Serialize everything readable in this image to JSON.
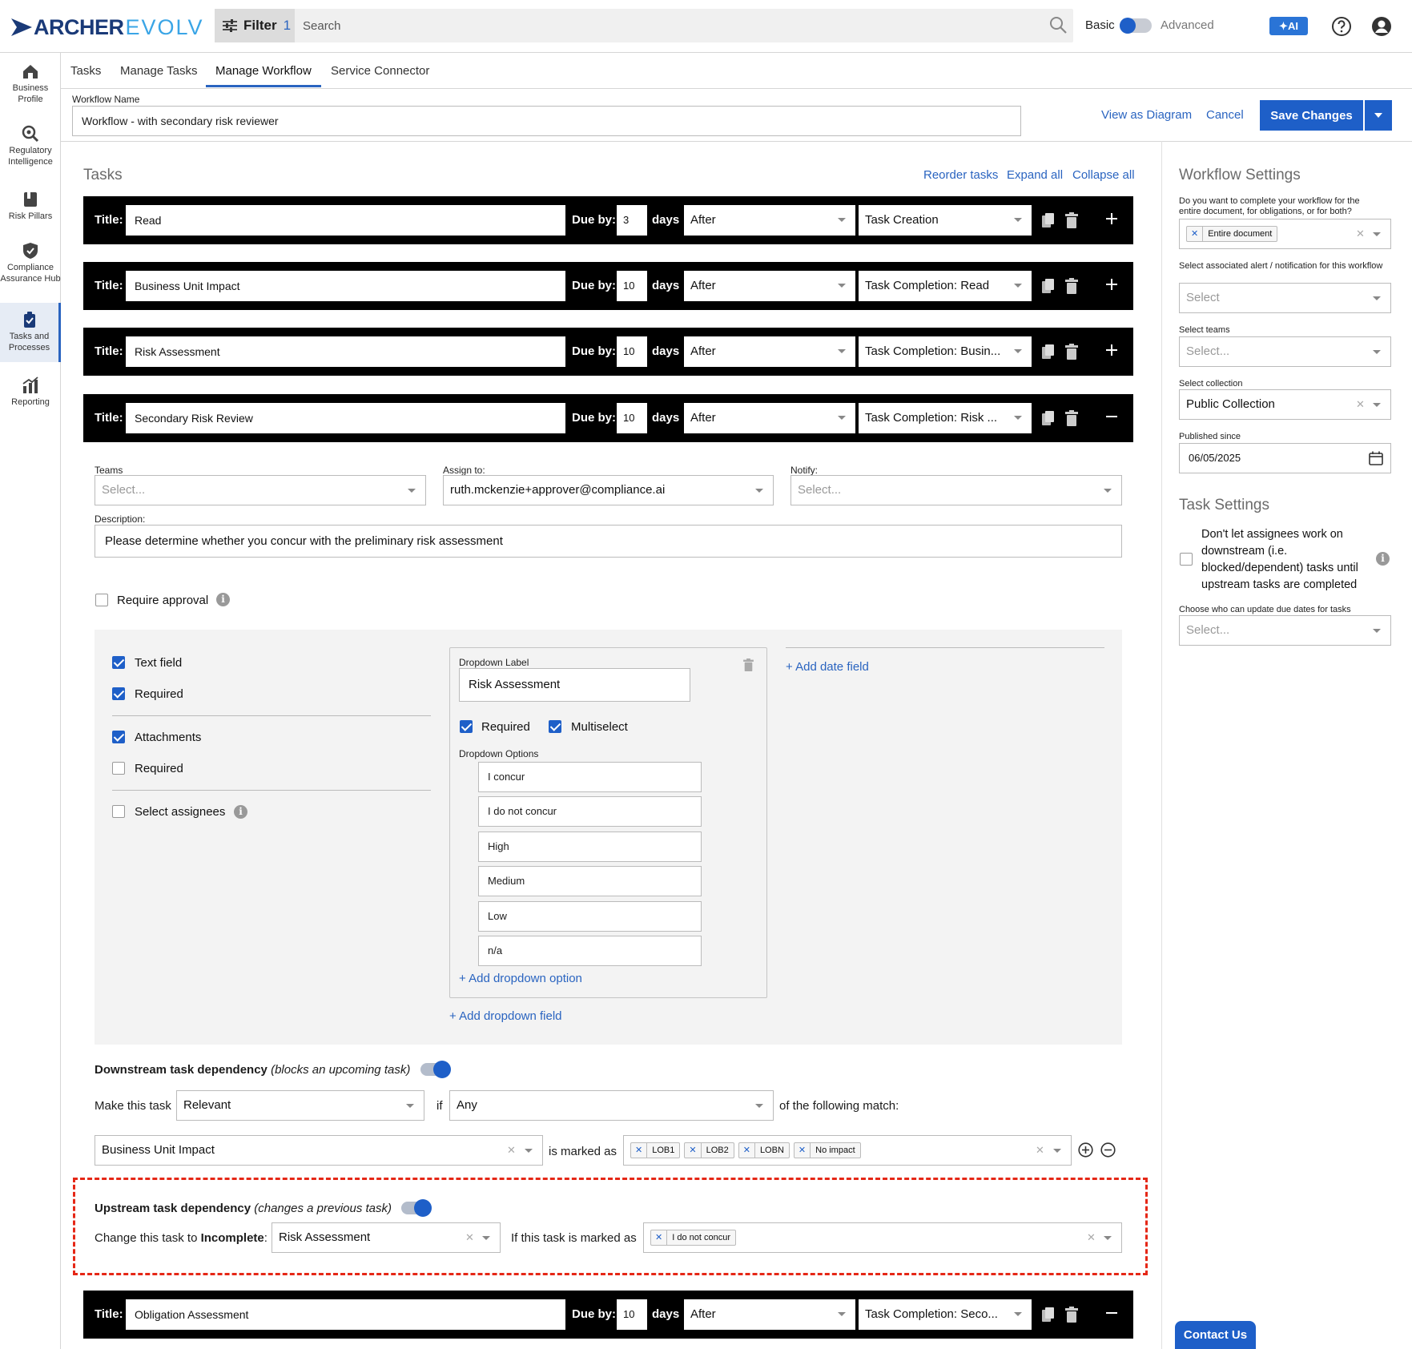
{
  "app": {
    "logo_main": "ARCHER",
    "logo_sub": "EVOLV",
    "filter_label": "Filter",
    "filter_count": "1",
    "search_label": "Search",
    "mode_basic": "Basic",
    "mode_advanced": "Advanced",
    "ai_label": "AI"
  },
  "nav": [
    {
      "label": "Business Profile",
      "icon": "house-icon"
    },
    {
      "label": "Regulatory Intelligence",
      "icon": "magnify-icon"
    },
    {
      "label": "Risk Pillars",
      "icon": "book-icon"
    },
    {
      "label": "Compliance Assurance Hub",
      "icon": "shield-icon"
    },
    {
      "label": "Tasks and Processes",
      "icon": "clipboard-icon"
    },
    {
      "label": "Reporting",
      "icon": "chart-icon"
    }
  ],
  "tabs": [
    "Tasks",
    "Manage Tasks",
    "Manage Workflow",
    "Service Connector"
  ],
  "workflow": {
    "name_label": "Workflow Name",
    "name_value": "Workflow - with secondary risk reviewer",
    "view_diagram": "View as Diagram",
    "cancel": "Cancel",
    "save": "Save Changes"
  },
  "tasks_header": {
    "title": "Tasks",
    "reorder": "Reorder tasks",
    "expand": "Expand all",
    "collapse": "Collapse all"
  },
  "row_labels": {
    "title": "Title:",
    "due_by": "Due by:",
    "days": "days"
  },
  "tasks": [
    {
      "title": "Read",
      "due": "3",
      "when": "After",
      "trigger": "Task Creation"
    },
    {
      "title": "Business Unit Impact",
      "due": "10",
      "when": "After",
      "trigger": "Task Completion: Read"
    },
    {
      "title": "Risk Assessment",
      "due": "10",
      "when": "After",
      "trigger": "Task Completion: Busin..."
    },
    {
      "title": "Secondary Risk Review",
      "due": "10",
      "when": "After",
      "trigger": "Task Completion: Risk ..."
    },
    {
      "title": "Obligation Assessment",
      "due": "10",
      "when": "After",
      "trigger": "Task Completion: Seco..."
    }
  ],
  "expanded": {
    "teams_label": "Teams",
    "teams_placeholder": "Select...",
    "assign_label": "Assign to:",
    "assign_value": "ruth.mckenzie+approver@compliance.ai",
    "notify_label": "Notify:",
    "notify_placeholder": "Select...",
    "description_label": "Description:",
    "description_value": "Please determine whether you concur with the preliminary risk assessment",
    "require_approval": "Require approval",
    "text_field": "Text field",
    "required": "Required",
    "attachments": "Attachments",
    "select_assignees": "Select assignees",
    "dropdown_label_title": "Dropdown Label",
    "dropdown_label_value": "Risk Assessment",
    "multiselect": "Multiselect",
    "dropdown_options_title": "Dropdown Options",
    "dropdown_options": [
      "I concur",
      "I do not concur",
      "High",
      "Medium",
      "Low",
      "n/a"
    ],
    "add_dropdown_option": "+ Add dropdown option",
    "add_dropdown_field": "+ Add dropdown field",
    "add_date_field": "+ Add date field"
  },
  "downstream": {
    "title_bold": "Downstream task dependency",
    "title_italic": "(blocks an upcoming task)",
    "make_this_task": "Make this task",
    "relevance": "Relevant",
    "if": "if",
    "any": "Any",
    "following": "of the following match:",
    "condition_task": "Business Unit Impact",
    "is_marked_as": "is marked as",
    "tags": [
      "LOB1",
      "LOB2",
      "LOBN",
      "No impact"
    ]
  },
  "upstream": {
    "title_bold": "Upstream task dependency",
    "title_italic": "(changes a previous task)",
    "change_prefix": "Change this task to ",
    "change_bold": "Incomplete",
    "change_suffix": ":",
    "target_task": "Risk Assessment",
    "if_marked": "If this task is marked as",
    "tags": [
      "I do not concur"
    ]
  },
  "workflow_settings": {
    "title": "Workflow Settings",
    "q1": "Do you want to complete your workflow for the entire document, for obligations, or for both?",
    "q1_tag": "Entire document",
    "q2": "Select associated alert / notification for this workflow",
    "q2_placeholder": "Select",
    "q3": "Select teams",
    "q3_placeholder": "Select...",
    "q4": "Select collection",
    "q4_value": "Public Collection",
    "q5": "Published since",
    "q5_value": "06/05/2025"
  },
  "task_settings": {
    "title": "Task Settings",
    "block_text": "Don't let assignees work on downstream (i.e. blocked/dependent) tasks until upstream tasks are completed",
    "due_label": "Choose who can update due dates for tasks",
    "due_placeholder": "Select..."
  },
  "contact_us": "Contact Us",
  "colors": {
    "accent": "#1e5fc8",
    "link": "#2a64c0",
    "highlight": "#e52716"
  }
}
